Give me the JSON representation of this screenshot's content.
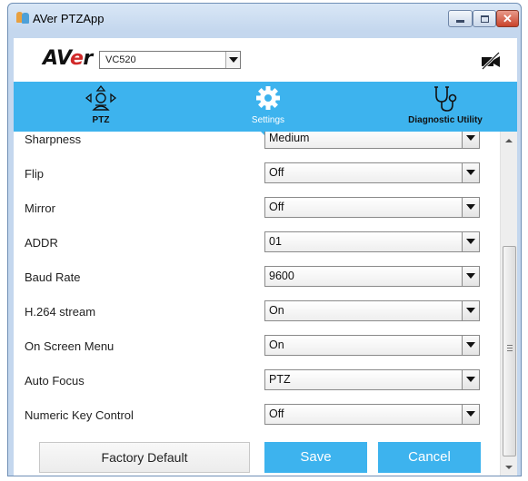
{
  "window": {
    "title": "AVer PTZApp",
    "close_glyph": "✕"
  },
  "header": {
    "logo_prefix": "AV",
    "logo_accent": "e",
    "logo_suffix": "r",
    "device": "VC520",
    "camera_icon": "camera-disabled-icon"
  },
  "nav": {
    "items": [
      {
        "label": "PTZ",
        "icon": "ptz-joystick-icon"
      },
      {
        "label": "Settings",
        "icon": "gear-icon",
        "active": true
      },
      {
        "label": "Diagnostic Utility",
        "icon": "stethoscope-icon"
      }
    ]
  },
  "settings": {
    "rows": [
      {
        "label": "Sharpness",
        "value": "Medium"
      },
      {
        "label": "Flip",
        "value": "Off"
      },
      {
        "label": "Mirror",
        "value": "Off"
      },
      {
        "label": "ADDR",
        "value": "01"
      },
      {
        "label": "Baud Rate",
        "value": "9600"
      },
      {
        "label": "H.264 stream",
        "value": "On"
      },
      {
        "label": "On Screen Menu",
        "value": "On"
      },
      {
        "label": "Auto Focus",
        "value": "PTZ"
      },
      {
        "label": "Numeric Key Control",
        "value": "Off"
      }
    ]
  },
  "buttons": {
    "factory_default": "Factory Default",
    "save": "Save",
    "cancel": "Cancel"
  },
  "colors": {
    "accent": "#3db3ee",
    "logo_accent": "#d12a2a"
  }
}
